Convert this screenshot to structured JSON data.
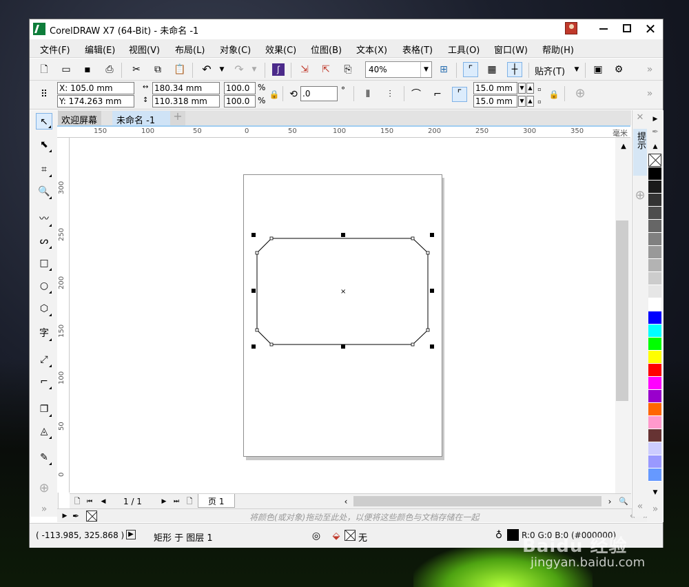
{
  "window": {
    "title": "CorelDRAW X7 (64-Bit) - 未命名 -1"
  },
  "menu": [
    "文件(F)",
    "编辑(E)",
    "视图(V)",
    "布局(L)",
    "对象(C)",
    "效果(C)",
    "位图(B)",
    "文本(X)",
    "表格(T)",
    "工具(O)",
    "窗口(W)",
    "帮助(H)"
  ],
  "toolbar": {
    "zoom": "40%",
    "snap": "贴齐(T)"
  },
  "properties": {
    "x": "X: 105.0 mm",
    "y": "Y: 174.263 mm",
    "width": "180.34 mm",
    "height": "110.318 mm",
    "scale_w": "100.0",
    "scale_h": "100.0",
    "percent": "%",
    "angle": ".0",
    "degree": "°",
    "corner1": "15.0 mm",
    "corner2": "15.0 mm"
  },
  "tabs": {
    "welcome": "欢迎屏幕",
    "document": "未命名 -1",
    "add": "+"
  },
  "ruler": {
    "unit": "毫米",
    "h_ticks": [
      "150",
      "100",
      "50",
      "0",
      "50",
      "100",
      "150",
      "200",
      "250",
      "300",
      "350"
    ],
    "v_ticks": [
      "300",
      "250",
      "200",
      "150",
      "100",
      "50",
      "0"
    ]
  },
  "page_nav": {
    "count": "1 / 1",
    "tab": "页 1"
  },
  "color_tray": {
    "hint": "将颜色(或对象)拖动至此处，以便将这些颜色与文档存储在一起"
  },
  "status": {
    "coords": "( -113.985, 325.868 )",
    "object": "矩形 于 图层 1",
    "fill": "无",
    "outline": "R:0 G:0 B:0 (#000000)"
  },
  "docker": {
    "hint": "提示"
  },
  "palette": [
    "#000000",
    "#1a1a1a",
    "#333333",
    "#4d4d4d",
    "#666666",
    "#808080",
    "#999999",
    "#b3b3b3",
    "#cccccc",
    "#e6e6e6",
    "#ffffff",
    "#0000ff",
    "#00ffff",
    "#00ff00",
    "#ffff00",
    "#ff0000",
    "#ff00ff",
    "#9900cc",
    "#ff6600",
    "#ff99cc",
    "#663333",
    "#ccccff",
    "#9999ff",
    "#6699ff"
  ],
  "watermark": {
    "brand": "Baidu 经验",
    "url": "jingyan.baidu.com"
  },
  "colors": {
    "accent": "#9fcdf1",
    "tab_active": "#cfe3f6",
    "annotation": "#e02020"
  }
}
